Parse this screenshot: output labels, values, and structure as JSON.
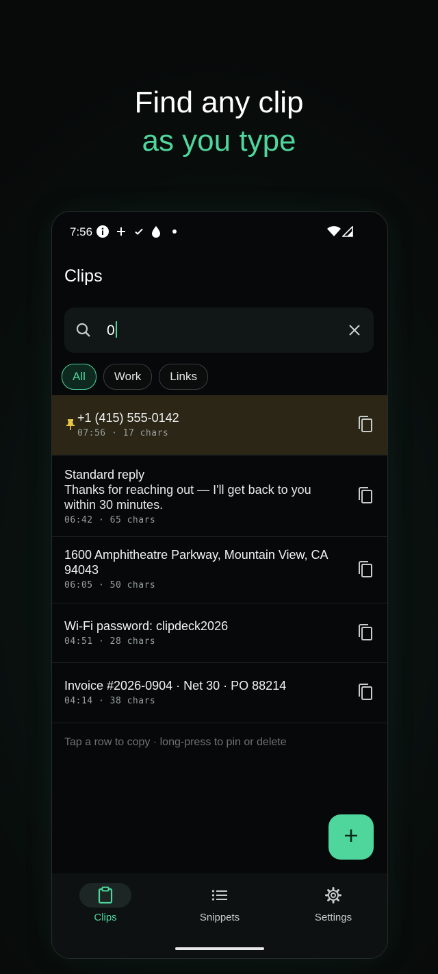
{
  "headline": {
    "line1": "Find any clip",
    "line2": "as you type"
  },
  "status_bar": {
    "time": "7:56",
    "icons": [
      "info-icon",
      "plus-icon",
      "check-icon",
      "water-drop-icon",
      "dot-icon",
      "wifi-icon",
      "signal-icon"
    ]
  },
  "app": {
    "title": "Clips"
  },
  "search": {
    "value": "0",
    "icon": "search-icon",
    "clear_icon": "close-icon"
  },
  "filters": [
    {
      "label": "All",
      "active": true
    },
    {
      "label": "Work",
      "active": false
    },
    {
      "label": "Links",
      "active": false
    }
  ],
  "clips": [
    {
      "title": "+1 (415) 555-0142",
      "meta": "07:56 · 17 chars",
      "pinned": true
    },
    {
      "title": "Standard reply",
      "body": "Thanks for reaching out — I'll get back to you within 30 minutes.",
      "meta": "06:42 · 65 chars",
      "pinned": false
    },
    {
      "title": "1600 Amphitheatre Parkway, Mountain View, CA 94043",
      "meta": "06:05 · 50 chars",
      "pinned": false
    },
    {
      "title": "Wi-Fi password: clipdeck2026",
      "meta": "04:51 · 28 chars",
      "pinned": false
    },
    {
      "title": "Invoice #2026-0904 · Net 30 · PO 88214",
      "meta": "04:14 · 38 chars",
      "pinned": false
    }
  ],
  "hint": "Tap a row to copy · long-press to pin or delete",
  "fab": {
    "icon": "plus-icon"
  },
  "nav": [
    {
      "label": "Clips",
      "icon": "clipboard-icon",
      "active": true
    },
    {
      "label": "Snippets",
      "icon": "list-icon",
      "active": false
    },
    {
      "label": "Settings",
      "icon": "gear-icon",
      "active": false
    }
  ],
  "colors": {
    "accent": "#4fd69c",
    "pinned_row": "#2b2616",
    "pin": "#e8c547",
    "background": "#060809"
  }
}
